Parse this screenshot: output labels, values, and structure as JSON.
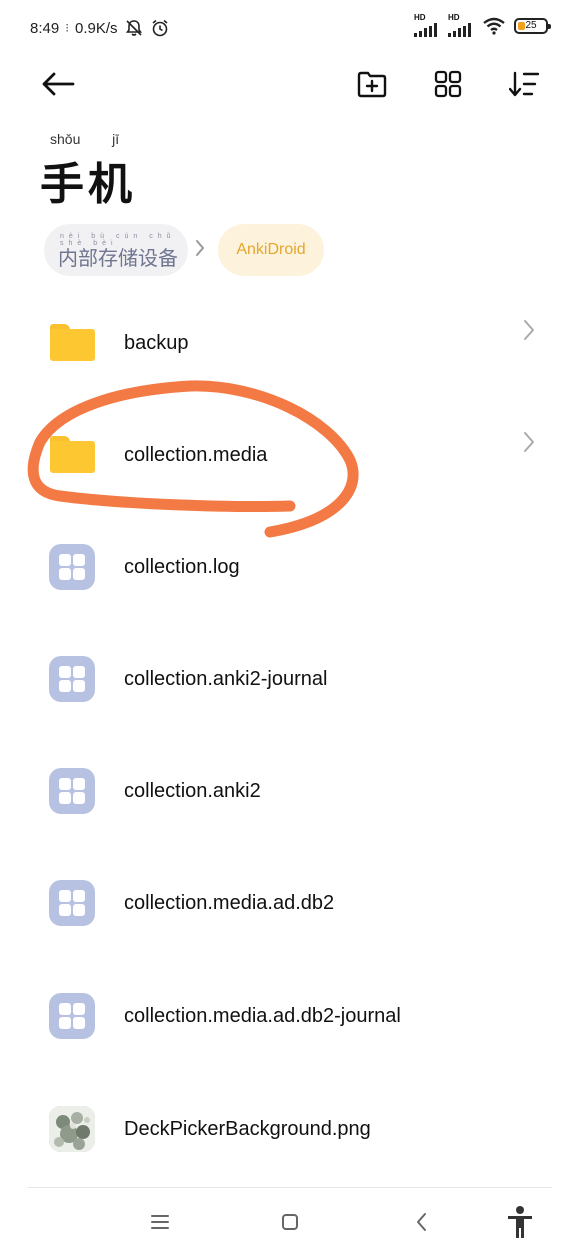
{
  "status_bar": {
    "time": "8:49",
    "speed": "0.9K/s",
    "signal_label_1": "HD",
    "signal_label_2": "HD",
    "battery": "25",
    "battery_color": "#f2a11d"
  },
  "toolbar": {
    "back_icon": "arrow-left-icon",
    "new_folder_icon": "folder-add-icon",
    "grid_view_icon": "grid-icon",
    "sort_icon": "sort-icon"
  },
  "header": {
    "title_pinyin_1": "shǒu",
    "title_pinyin_2": "jī",
    "title": "手机"
  },
  "breadcrumb": {
    "items": [
      {
        "pinyin": "nèi bù cún chǔ shè bèi",
        "label": "内部存储设备"
      },
      {
        "label": "AnkiDroid"
      }
    ],
    "active_color": "#e4a72f"
  },
  "files": [
    {
      "name": "backup",
      "type": "folder"
    },
    {
      "name": "collection.media",
      "type": "folder"
    },
    {
      "name": "collection.log",
      "type": "file"
    },
    {
      "name": "collection.anki2-journal",
      "type": "file"
    },
    {
      "name": "collection.anki2",
      "type": "file"
    },
    {
      "name": "collection.media.ad.db2",
      "type": "file"
    },
    {
      "name": "collection.media.ad.db2-journal",
      "type": "file"
    },
    {
      "name": "DeckPickerBackground.png",
      "type": "image"
    }
  ],
  "annotation": {
    "color": "#f47a45"
  },
  "nav_bar": {
    "menu_icon": "menu-icon",
    "home_icon": "home-square-icon",
    "back_icon": "chevron-left-icon",
    "accessibility_icon": "accessibility-icon"
  }
}
